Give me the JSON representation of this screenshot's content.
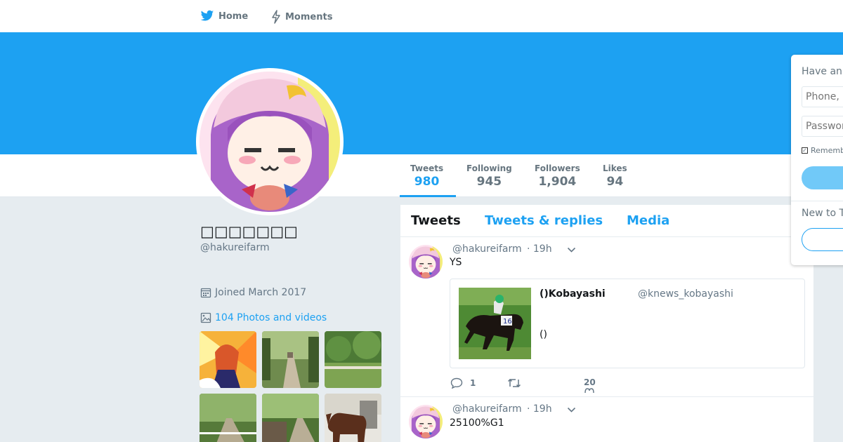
{
  "nav": {
    "home_label": "Home",
    "moments_label": "Moments"
  },
  "colors": {
    "brand": "#1da1f2",
    "text": "#14171a",
    "muted": "#657786",
    "background": "#e6ecf0"
  },
  "stats": [
    {
      "label": "Tweets",
      "value": "980"
    },
    {
      "label": "Following",
      "value": "945"
    },
    {
      "label": "Followers",
      "value": "1,904"
    },
    {
      "label": "Likes",
      "value": "94"
    }
  ],
  "profile": {
    "display_name": "□□□□□□□",
    "handle": "@hakureifarm",
    "joined": "Joined March 2017",
    "photos_link": "104 Photos and videos"
  },
  "timeline": {
    "tabs": [
      "Tweets",
      "Tweets & replies",
      "Media"
    ],
    "tweets": [
      {
        "handle": "@hakureifarm",
        "time": "· 19h",
        "text": "YS",
        "quote": {
          "name": "()Kobayashi",
          "handle": "@knews_kobayashi",
          "text": "()"
        },
        "reply_count": "1",
        "like_count": "20"
      },
      {
        "handle": "@hakureifarm",
        "time": "· 19h",
        "text": "25100%G1"
      }
    ]
  },
  "login": {
    "title": "Have an",
    "phone_placeholder": "Phone, e",
    "password_placeholder": "Passwor",
    "remember": "Rememb",
    "new_prompt": "New to T"
  },
  "icons": {
    "home": "bird-icon",
    "moments": "lightning-icon",
    "joined": "calendar-icon",
    "photos": "image-icon",
    "reply": "reply-icon",
    "retweet": "retweet-icon",
    "like": "heart-icon",
    "caret": "chevron-down-icon"
  }
}
